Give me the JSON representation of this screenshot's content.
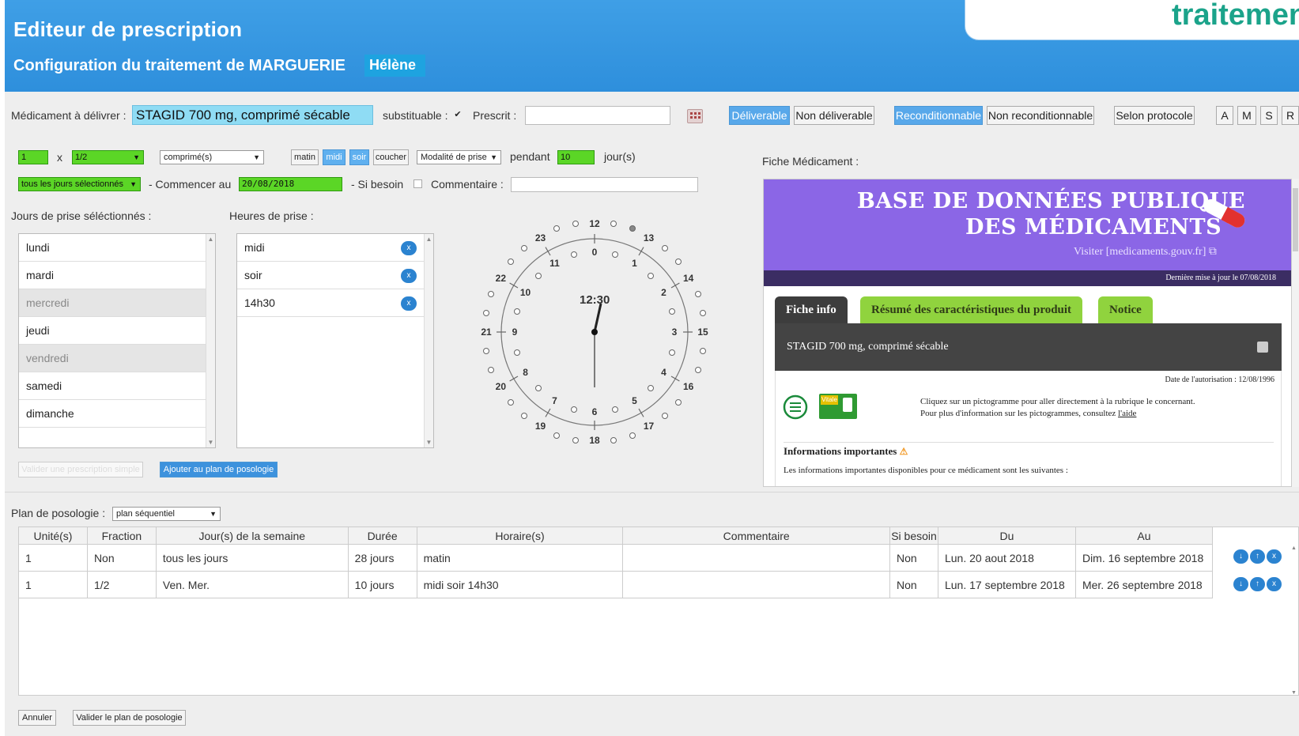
{
  "header": {
    "title": "Editeur de prescription",
    "subtitle": "Configuration du traitement de MARGUERIE",
    "patient_first": "Hélène",
    "brand": "traitemen"
  },
  "toolbar": {
    "med_label": "Médicament à délivrer :",
    "med_value": "STAGID 700 mg, comprimé sécable",
    "subst_label": "substituable :",
    "subst_check": "✔",
    "prescrit_label": "Prescrit :",
    "buttons": [
      "Déliverable",
      "Non déliverable",
      "Reconditionnable",
      "Non reconditionnable",
      "Selon protocole"
    ],
    "letters": [
      "A",
      "M",
      "S",
      "R"
    ]
  },
  "dose": {
    "qty": "1",
    "x": "x",
    "fraction": "1/2",
    "form": "comprimé(s)",
    "moments": [
      "matin",
      "midi",
      "soir",
      "coucher"
    ],
    "modalite": "Modalité de prise",
    "pendant": "pendant",
    "days": "10",
    "days_unit": "jour(s)",
    "freq": "tous les jours sélectionnés",
    "start_label": "- Commencer au",
    "start_date": "20/08/2018",
    "si_besoin": "- Si besoin",
    "comment_label": "Commentaire :"
  },
  "days_panel": {
    "label": "Jours de prise séléctionnés :",
    "days": [
      "lundi",
      "mardi",
      "mercredi",
      "jeudi",
      "vendredi",
      "samedi",
      "dimanche"
    ]
  },
  "hours_panel": {
    "label": "Heures de prise :",
    "hours": [
      "midi",
      "soir",
      "14h30"
    ],
    "remove": "x"
  },
  "clock": {
    "time": "12:30",
    "outer": [
      "0",
      "1",
      "2",
      "3",
      "4",
      "5",
      "6",
      "7",
      "8",
      "9",
      "10",
      "11"
    ],
    "inner": [
      "12",
      "13",
      "14",
      "15",
      "16",
      "17",
      "18",
      "19",
      "20",
      "21",
      "22",
      "23"
    ]
  },
  "actions": {
    "simple": "Valider une prescription simple",
    "add": "Ajouter au plan de posologie"
  },
  "fiche": {
    "label": "Fiche Médicament :",
    "title1": "BASE DE DONNÉES PUBLIQUE",
    "title2": "DES MÉDICAMENTS",
    "visit": "Visiter [medicaments.gouv.fr]",
    "updated": "Dernière mise à jour le 07/08/2018",
    "tabs": [
      "Fiche info",
      "Résumé des caractéristiques du produit",
      "Notice"
    ],
    "drug": "STAGID 700 mg, comprimé sécable",
    "auth": "Date de l'autorisation : 12/08/1996",
    "vitale": "Vitale",
    "hint1": "Cliquez sur un pictogramme pour aller directement à la rubrique le concernant.",
    "hint2": "Pour plus d'information sur les pictogrammes, consultez ",
    "hint_link": "l'aide",
    "info_title": "Informations importantes",
    "info_text": "Les informations importantes disponibles pour ce médicament sont les suivantes :"
  },
  "plan": {
    "label": "Plan de posologie :",
    "mode": "plan séquentiel",
    "columns": [
      "Unité(s)",
      "Fraction",
      "Jour(s) de la semaine",
      "Durée",
      "Horaire(s)",
      "Commentaire",
      "Si besoin",
      "Du",
      "Au"
    ],
    "rows": [
      [
        "1",
        "Non",
        "tous les jours",
        "28 jours",
        "matin",
        "",
        "Non",
        "Lun. 20 aout 2018",
        "Dim. 16 septembre 2018"
      ],
      [
        "1",
        "1/2",
        "Ven. Mer.",
        "10 jours",
        "midi soir 14h30",
        "",
        "Non",
        "Lun. 17 septembre 2018",
        "Mer. 26 septembre 2018"
      ]
    ],
    "row_buttons": [
      "↓",
      "↑",
      "x"
    ]
  },
  "footer": {
    "cancel": "Annuler",
    "validate": "Valider le plan de posologie"
  }
}
